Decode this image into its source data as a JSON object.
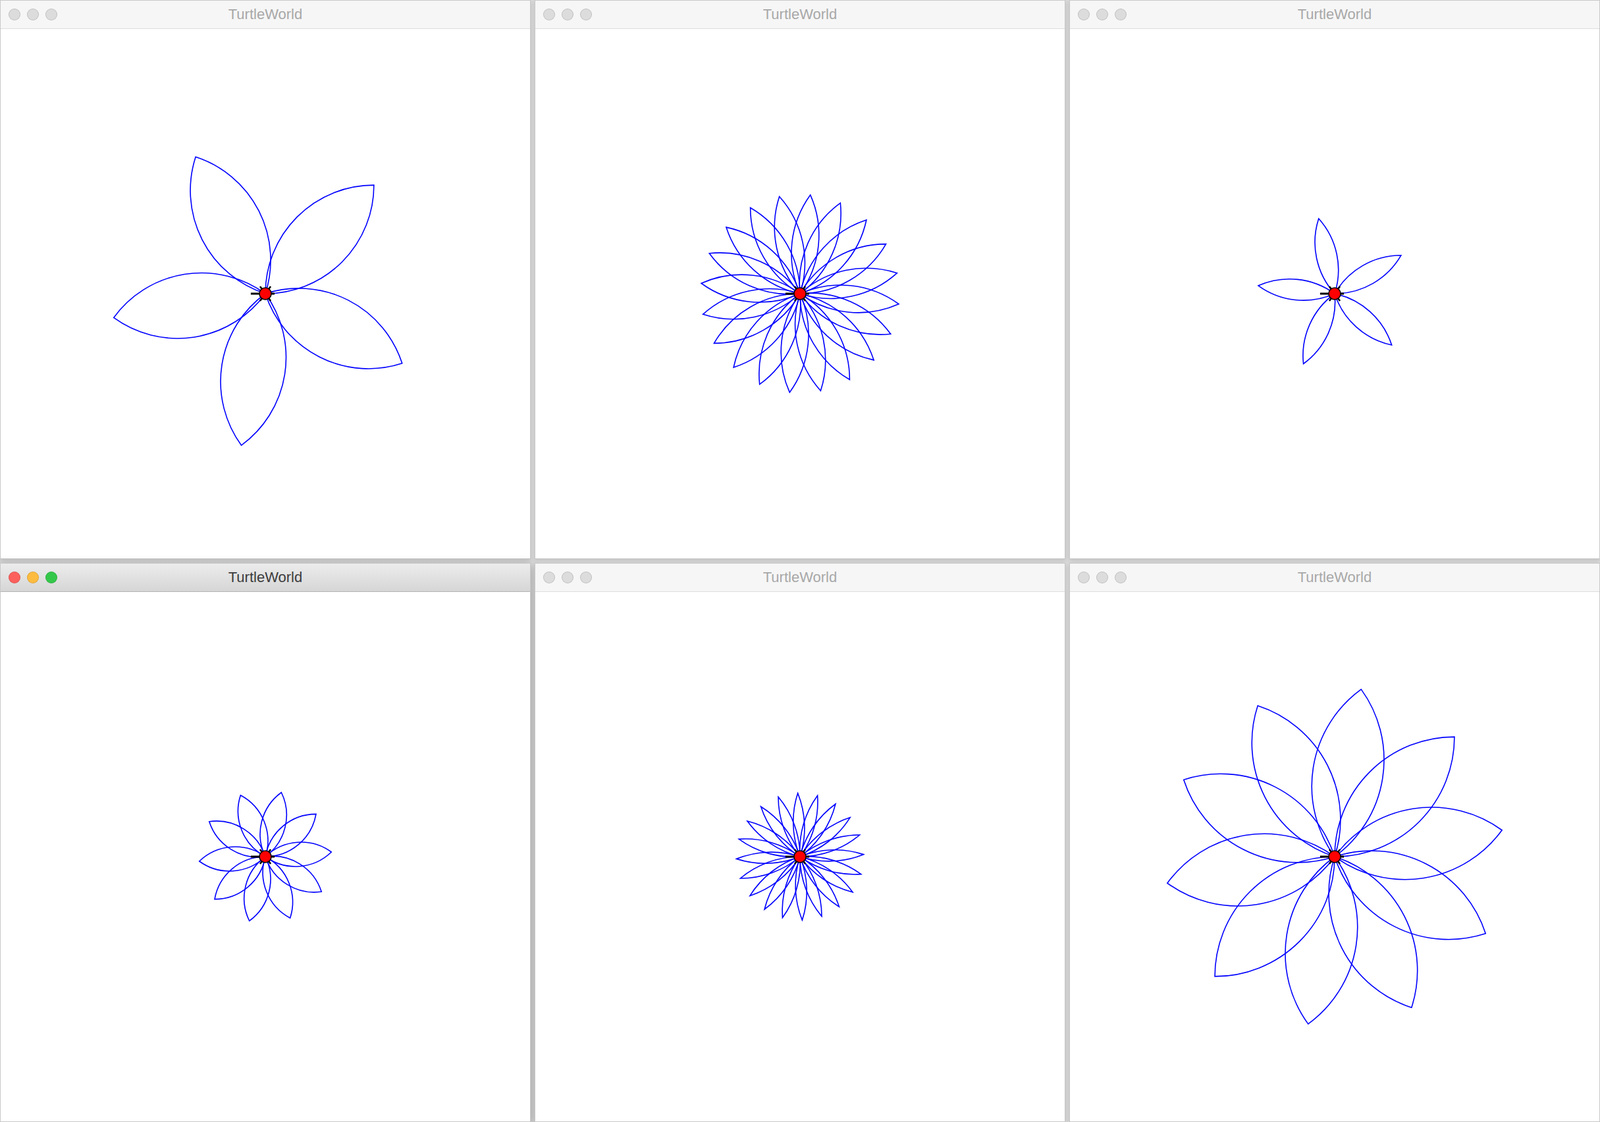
{
  "windows": [
    {
      "title": "TurtleWorld",
      "focused": false,
      "flower": {
        "petals": 5,
        "length": 232,
        "angle": 90,
        "color": "#0000ff"
      }
    },
    {
      "title": "TurtleWorld",
      "focused": false,
      "flower": {
        "petals": 20,
        "length": 150,
        "angle": 60,
        "color": "#0000ff"
      }
    },
    {
      "title": "TurtleWorld",
      "focused": false,
      "flower": {
        "petals": 5,
        "length": 116,
        "angle": 60,
        "color": "#0000ff"
      }
    },
    {
      "title": "TurtleWorld",
      "focused": true,
      "flower": {
        "petals": 10,
        "length": 100,
        "angle": 80,
        "color": "#0000ff"
      }
    },
    {
      "title": "TurtleWorld",
      "focused": false,
      "flower": {
        "petals": 20,
        "length": 96,
        "angle": 40,
        "color": "#0000ff"
      }
    },
    {
      "title": "TurtleWorld",
      "focused": false,
      "flower": {
        "petals": 10,
        "length": 256,
        "angle": 90,
        "color": "#0000ff"
      }
    }
  ]
}
